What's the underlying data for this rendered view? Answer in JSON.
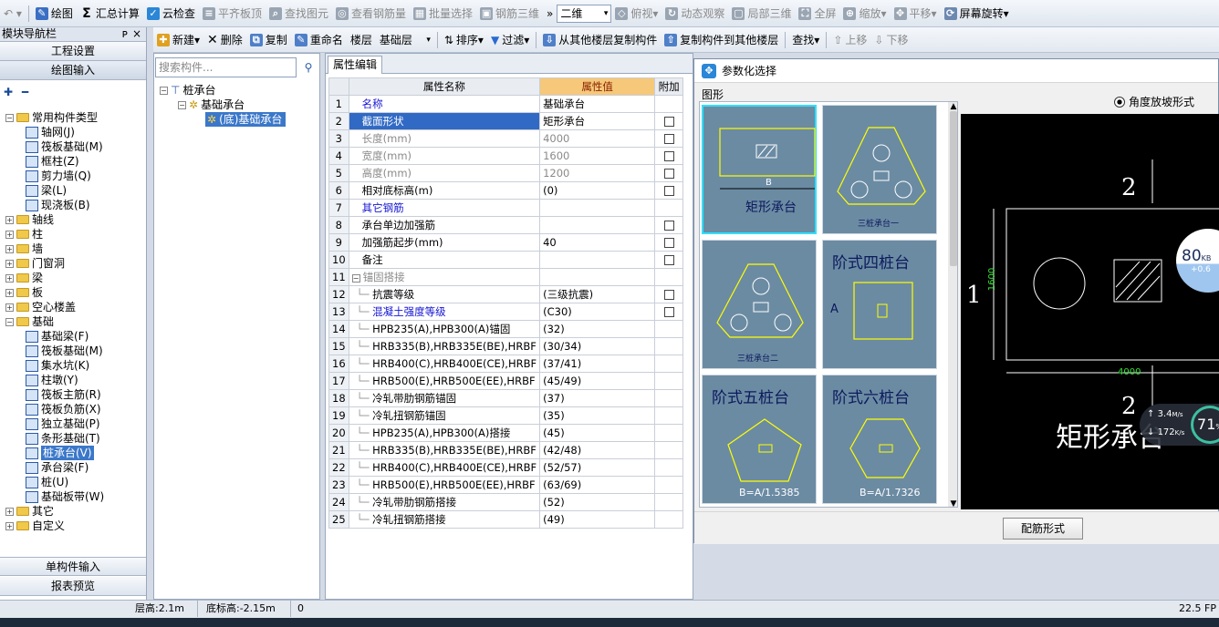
{
  "toolbar1": {
    "items": [
      {
        "label": "绘图",
        "icon": "brush-icon"
      },
      {
        "label": "汇总计算",
        "icon": "sigma-icon"
      },
      {
        "label": "云检查",
        "icon": "cloud-check-icon"
      },
      {
        "label": "平齐板顶",
        "icon": "align-icon"
      },
      {
        "label": "查找图元",
        "icon": "find-icon"
      },
      {
        "label": "查看钢筋量",
        "icon": "view-icon"
      },
      {
        "label": "批量选择",
        "icon": "batch-icon"
      },
      {
        "label": "钢筋三维",
        "icon": "3d-icon"
      }
    ],
    "view_combo": "二维",
    "view_items": [
      "俯视",
      "动态观察",
      "局部三维",
      "全屏",
      "缩放",
      "平移",
      "屏幕旋转"
    ]
  },
  "toolbar2": {
    "new": "新建",
    "delete": "删除",
    "copy": "复制",
    "rename": "重命名",
    "floor_label": "楼层",
    "floor_value": "基础层",
    "sort": "排序",
    "filter": "过滤",
    "copy_from": "从其他楼层复制构件",
    "copy_to": "复制构件到其他楼层",
    "find": "查找",
    "up": "上移",
    "down": "下移"
  },
  "nav": {
    "title": "模块导航栏",
    "pin": "ᴘ",
    "close": "×",
    "btn_project": "工程设置",
    "btn_draw": "绘图输入",
    "btn_single": "单构件输入",
    "btn_report": "报表预览",
    "tree": [
      {
        "label": "常用构件类型",
        "level": 0,
        "kind": "folder",
        "open": true
      },
      {
        "label": "轴网(J)",
        "level": 1,
        "kind": "item"
      },
      {
        "label": "筏板基础(M)",
        "level": 1,
        "kind": "item"
      },
      {
        "label": "框柱(Z)",
        "level": 1,
        "kind": "item"
      },
      {
        "label": "剪力墙(Q)",
        "level": 1,
        "kind": "item"
      },
      {
        "label": "梁(L)",
        "level": 1,
        "kind": "item"
      },
      {
        "label": "现浇板(B)",
        "level": 1,
        "kind": "item"
      },
      {
        "label": "轴线",
        "level": 0,
        "kind": "folder"
      },
      {
        "label": "柱",
        "level": 0,
        "kind": "folder"
      },
      {
        "label": "墙",
        "level": 0,
        "kind": "folder"
      },
      {
        "label": "门窗洞",
        "level": 0,
        "kind": "folder"
      },
      {
        "label": "梁",
        "level": 0,
        "kind": "folder"
      },
      {
        "label": "板",
        "level": 0,
        "kind": "folder"
      },
      {
        "label": "空心楼盖",
        "level": 0,
        "kind": "folder"
      },
      {
        "label": "基础",
        "level": 0,
        "kind": "folder",
        "open": true
      },
      {
        "label": "基础梁(F)",
        "level": 1,
        "kind": "item"
      },
      {
        "label": "筏板基础(M)",
        "level": 1,
        "kind": "item"
      },
      {
        "label": "集水坑(K)",
        "level": 1,
        "kind": "item"
      },
      {
        "label": "柱墩(Y)",
        "level": 1,
        "kind": "item"
      },
      {
        "label": "筏板主筋(R)",
        "level": 1,
        "kind": "item"
      },
      {
        "label": "筏板负筋(X)",
        "level": 1,
        "kind": "item"
      },
      {
        "label": "独立基础(P)",
        "level": 1,
        "kind": "item"
      },
      {
        "label": "条形基础(T)",
        "level": 1,
        "kind": "item"
      },
      {
        "label": "桩承台(V)",
        "level": 1,
        "kind": "item",
        "selected": true
      },
      {
        "label": "承台梁(F)",
        "level": 1,
        "kind": "item"
      },
      {
        "label": "桩(U)",
        "level": 1,
        "kind": "item"
      },
      {
        "label": "基础板带(W)",
        "level": 1,
        "kind": "item"
      },
      {
        "label": "其它",
        "level": 0,
        "kind": "folder"
      },
      {
        "label": "自定义",
        "level": 0,
        "kind": "folder"
      }
    ]
  },
  "component_tree": {
    "search_placeholder": "搜索构件...",
    "root": "桩承台",
    "child": "基础承台",
    "leaf": "(底)基础承台"
  },
  "properties": {
    "tab": "属性编辑",
    "col_name": "属性名称",
    "col_value": "属性值",
    "col_extra": "附加",
    "rows": [
      {
        "n": "1",
        "name": "名称",
        "value": "基础承台",
        "chk": false,
        "style": "blue"
      },
      {
        "n": "2",
        "name": "截面形状",
        "value": "矩形承台",
        "chk": true,
        "style": "sel"
      },
      {
        "n": "3",
        "name": "长度(mm)",
        "value": "4000",
        "chk": true,
        "style": "gray"
      },
      {
        "n": "4",
        "name": "宽度(mm)",
        "value": "1600",
        "chk": true,
        "style": "gray"
      },
      {
        "n": "5",
        "name": "高度(mm)",
        "value": "1200",
        "chk": true,
        "style": "gray"
      },
      {
        "n": "6",
        "name": "相对底标高(m)",
        "value": "(0)",
        "chk": true,
        "style": ""
      },
      {
        "n": "7",
        "name": "其它钢筋",
        "value": "",
        "chk": false,
        "style": "blue"
      },
      {
        "n": "8",
        "name": "承台单边加强筋",
        "value": "",
        "chk": true,
        "style": ""
      },
      {
        "n": "9",
        "name": "加强筋起步(mm)",
        "value": "40",
        "chk": true,
        "style": ""
      },
      {
        "n": "10",
        "name": "备注",
        "value": "",
        "chk": true,
        "style": ""
      },
      {
        "n": "11",
        "name": "锚固搭接",
        "value": "",
        "chk": false,
        "style": "group"
      },
      {
        "n": "12",
        "name": "抗震等级",
        "value": "(三级抗震)",
        "chk": true,
        "style": "sub"
      },
      {
        "n": "13",
        "name": "混凝土强度等级",
        "value": "(C30)",
        "chk": true,
        "style": "subblue"
      },
      {
        "n": "14",
        "name": "HPB235(A),HPB300(A)锚固",
        "value": "(32)",
        "chk": false,
        "style": "sub"
      },
      {
        "n": "15",
        "name": "HRB335(B),HRB335E(BE),HRBF",
        "value": "(30/34)",
        "chk": false,
        "style": "sub"
      },
      {
        "n": "16",
        "name": "HRB400(C),HRB400E(CE),HRBF",
        "value": "(37/41)",
        "chk": false,
        "style": "sub"
      },
      {
        "n": "17",
        "name": "HRB500(E),HRB500E(EE),HRBF",
        "value": "(45/49)",
        "chk": false,
        "style": "sub"
      },
      {
        "n": "18",
        "name": "冷轧带肋钢筋锚固",
        "value": "(37)",
        "chk": false,
        "style": "sub"
      },
      {
        "n": "19",
        "name": "冷轧扭钢筋锚固",
        "value": "(35)",
        "chk": false,
        "style": "sub"
      },
      {
        "n": "20",
        "name": "HPB235(A),HPB300(A)搭接",
        "value": "(45)",
        "chk": false,
        "style": "sub"
      },
      {
        "n": "21",
        "name": "HRB335(B),HRB335E(BE),HRBF",
        "value": "(42/48)",
        "chk": false,
        "style": "sub"
      },
      {
        "n": "22",
        "name": "HRB400(C),HRB400E(CE),HRBF",
        "value": "(52/57)",
        "chk": false,
        "style": "sub"
      },
      {
        "n": "23",
        "name": "HRB500(E),HRB500E(EE),HRBF",
        "value": "(63/69)",
        "chk": false,
        "style": "sub"
      },
      {
        "n": "24",
        "name": "冷轧带肋钢筋搭接",
        "value": "(52)",
        "chk": false,
        "style": "sub"
      },
      {
        "n": "25",
        "name": "冷轧扭钢筋搭接",
        "value": "(49)",
        "chk": false,
        "style": "sub"
      }
    ]
  },
  "dialog": {
    "title": "参数化选择",
    "group_label": "图形",
    "radio_label": "角度放坡形式",
    "ok": "配筋形式",
    "cards": [
      {
        "label": "矩形承台",
        "sub": "B"
      },
      {
        "label": "三桩承台一",
        "sub": ""
      },
      {
        "label": "三桩承台二",
        "sub": ""
      },
      {
        "label": "阶式四桩台",
        "sub": "A"
      },
      {
        "label": "阶式五桩台",
        "sub": "B=A/1.5385"
      },
      {
        "label": "阶式六桩台",
        "sub": "B=A/1.7326"
      }
    ],
    "preview": {
      "title": "矩形承台",
      "dim_w": "4000",
      "dim_h": "1600",
      "axis_top": "2",
      "axis_bottom": "2",
      "axis_left": "1",
      "speed_up": "3.4",
      "speed_up_unit": "M/s",
      "speed_down": "172",
      "speed_down_unit": "K/s",
      "cpu": "71",
      "mem": "80",
      "mem_unit": "KB",
      "mem_sub": "+0.6"
    }
  },
  "status": {
    "floor_height": "层高:2.1m",
    "bottom_elev": "底标高:-2.15m",
    "value": "0",
    "fps": "22.5 FP"
  }
}
